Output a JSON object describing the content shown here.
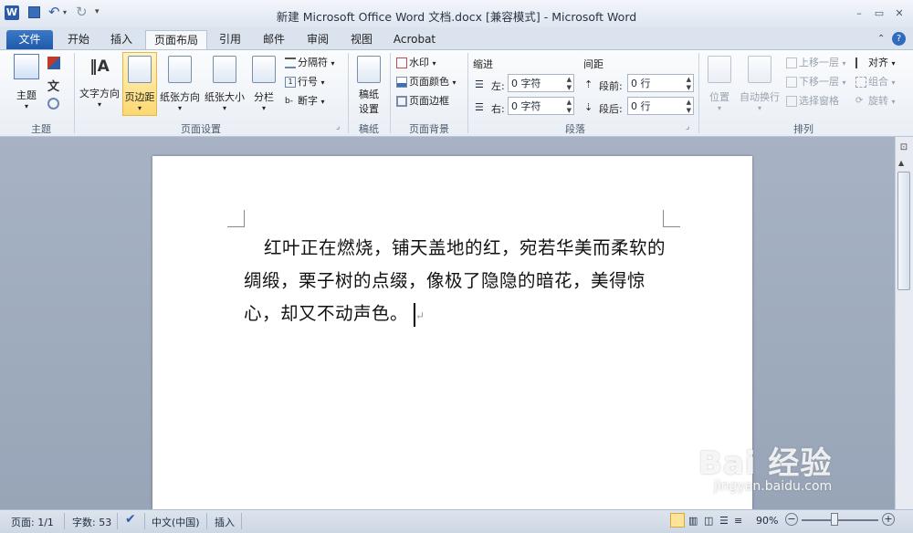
{
  "window": {
    "title": "新建 Microsoft Office Word 文档.docx [兼容模式] - Microsoft Word",
    "app_icon": "W",
    "minimize": "–",
    "restore": "▭",
    "close": "✕"
  },
  "tabs": [
    {
      "label": "文件"
    },
    {
      "label": "开始"
    },
    {
      "label": "插入"
    },
    {
      "label": "页面布局"
    },
    {
      "label": "引用"
    },
    {
      "label": "邮件"
    },
    {
      "label": "审阅"
    },
    {
      "label": "视图"
    },
    {
      "label": "Acrobat"
    }
  ],
  "ribbon": {
    "theme": {
      "label": "主题",
      "group": "主题"
    },
    "page_setup": {
      "text_direction": "文字方向",
      "margins": "页边距",
      "orientation": "纸张方向",
      "size": "纸张大小",
      "columns": "分栏",
      "breaks": "分隔符",
      "line_numbers": "行号",
      "hyphenation": "断字",
      "group": "页面设置"
    },
    "manuscript": {
      "label1": "稿纸",
      "label2": "设置",
      "group": "稿纸"
    },
    "background": {
      "watermark": "水印",
      "page_color": "页面颜色",
      "page_border": "页面边框",
      "group": "页面背景"
    },
    "paragraph": {
      "indent_title": "缩进",
      "left_label": "左:",
      "left_value": "0 字符",
      "right_label": "右:",
      "right_value": "0 字符",
      "spacing_title": "间距",
      "before_label": "段前:",
      "before_value": "0 行",
      "after_label": "段后:",
      "after_value": "0 行",
      "group": "段落"
    },
    "arrange": {
      "position": "位置",
      "wrap": "自动换行",
      "bring_forward": "上移一层",
      "send_backward": "下移一层",
      "selection_pane": "选择窗格",
      "align": "对齐",
      "group_btn": "组合",
      "rotate": "旋转",
      "group": "排列"
    }
  },
  "document": {
    "text": "红叶正在燃烧，铺天盖地的红，宛若华美而柔软的绸缎，栗子树的点缀，像极了隐隐的暗花，美得惊心，却又不动声色。",
    "para_mark": "↵"
  },
  "statusbar": {
    "page": "页面: 1/1",
    "words": "字数: 53",
    "language": "中文(中国)",
    "mode": "插入",
    "zoom": "90%"
  },
  "watermark": {
    "brand": "Bai 经验",
    "url": "jingyan.baidu.com"
  },
  "colors": {
    "file_tab": "#2a66b8",
    "ribbon_bg": "#f3f6fa",
    "workspace": "#9ba8ba",
    "highlight": "#fde49a"
  }
}
